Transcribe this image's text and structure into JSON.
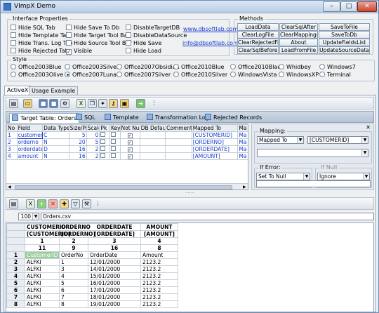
{
  "window": {
    "title": "VImpX Demo",
    "min": "–",
    "max": "□",
    "close": "✕"
  },
  "interface": {
    "title": "Interface Properties",
    "col1": [
      {
        "label": "Hide SQL Tab",
        "checked": false
      },
      {
        "label": "Hide Template Tab",
        "checked": false
      },
      {
        "label": "Hide Trans. Log Tab",
        "checked": false
      },
      {
        "label": "Hide Rejected Tab",
        "checked": false
      }
    ],
    "col2": [
      {
        "label": "Hide Save To Db",
        "checked": false
      },
      {
        "label": "Hide Target Tool Bar",
        "checked": false
      },
      {
        "label": "Hide Source Tool Bar",
        "checked": false
      },
      {
        "label": "Visible",
        "checked": true
      }
    ],
    "col3": [
      {
        "label": "DisableTargetDB",
        "checked": false
      },
      {
        "label": "DisableDataSource",
        "checked": false
      },
      {
        "label": "Hide Save",
        "checked": false
      },
      {
        "label": "Hide Load",
        "checked": false
      }
    ],
    "link1": "www.dbsoftlab.com",
    "link2": "info@dbsoftlab.com"
  },
  "methods": {
    "title": "Methods",
    "rows": [
      [
        "LoadData",
        "ClearSqlAfter",
        "SaveToFile"
      ],
      [
        "ClearLogFile",
        "ClearMappings",
        "SaveToDb"
      ],
      [
        "ClearRejectedFile",
        "About",
        "UpdateFieldsList"
      ],
      [
        "ClearSqlBefore",
        "LoadFromFile",
        "UpdateSourceData"
      ]
    ]
  },
  "style": {
    "title": "Style",
    "row1": [
      "Office2003Blue",
      "Office2003Silver",
      "Office2007Obsidian",
      "Office2010Blue",
      "Office2010Black",
      "Whidbey",
      "Windows7"
    ],
    "row2": [
      "Office2003Olive",
      "Office2007Luna",
      "Office2007Silver",
      "Office2010Silver",
      "WindowsVista",
      "WindowsXP",
      "Terminal"
    ],
    "selected": "Office2007Luna"
  },
  "tabs": [
    "ActiveX",
    "Usage Example"
  ],
  "ribbon_tabs": [
    "Target Table: Orders",
    "SQL",
    "Template",
    "Transformation Log",
    "Rejected Records"
  ],
  "fields_table": {
    "headers": [
      "No",
      "Field",
      "Data Type",
      "Size/Pr",
      "Scale",
      "Pk",
      "Key",
      "Not Null",
      "DB Default",
      "Comments",
      "Mapped To",
      "Ma"
    ],
    "rows": [
      {
        "no": "1",
        "field": "customerid",
        "type": "C",
        "size": "5",
        "scale": "0",
        "notnull": true,
        "mapped": "[CUSTOMERID]",
        "ma": "Ma"
      },
      {
        "no": "2",
        "field": "orderno",
        "type": "N",
        "size": "20",
        "scale": "5",
        "notnull": true,
        "mapped": "[ORDERNO]",
        "ma": "Ma"
      },
      {
        "no": "3",
        "field": "orderdate",
        "type": "D",
        "size": "16",
        "scale": "2",
        "notnull": true,
        "mapped": "[ORDERDATE]",
        "ma": "Ma"
      },
      {
        "no": "4",
        "field": "amount",
        "type": "N",
        "size": "16",
        "scale": "2",
        "notnull": true,
        "mapped": "[AMOUNT]",
        "ma": "Ma"
      }
    ]
  },
  "mapping": {
    "title": "Mapping:",
    "type_value": "Mapped To",
    "field_value": "[CUSTOMERID]",
    "iferror_title": "If Error:",
    "iferror_value": "Set To Null",
    "ifnull_title": "If Null",
    "ifnull_value": "Ignore"
  },
  "source": {
    "zoom": "100",
    "file": "Orders.csv",
    "header_names": [
      "CUSTOMERID",
      "ORDERNO",
      "ORDERDATE",
      "AMOUNT"
    ],
    "header_maps": [
      "[CUSTOMERID]",
      "[ORDERNO]",
      "[ORDERDATE]",
      "[AMOUNT]"
    ],
    "header_nums": [
      "1",
      "2",
      "3",
      "4"
    ],
    "header_widths": [
      "11",
      "9",
      "16",
      "8"
    ],
    "col_names": [
      "CustomerID",
      "OrderNo",
      "OrderDate",
      "Amount"
    ],
    "rows": [
      [
        "2",
        "ALFKI",
        "1",
        "12/01/2000",
        "2123.2"
      ],
      [
        "3",
        "ALFKI",
        "3",
        "14/01/2000",
        "2123.2"
      ],
      [
        "4",
        "ALFKI",
        "4",
        "15/01/2000",
        "2123.2"
      ],
      [
        "5",
        "ALFKI",
        "5",
        "16/01/2000",
        "2123.2"
      ],
      [
        "6",
        "ALFKI",
        "6",
        "17/01/2000",
        "2123.2"
      ],
      [
        "7",
        "ALFKI",
        "7",
        "18/01/2000",
        "2123.2"
      ],
      [
        "8",
        "ALFKI",
        "8",
        "19/01/2000",
        "2123.2"
      ]
    ]
  }
}
